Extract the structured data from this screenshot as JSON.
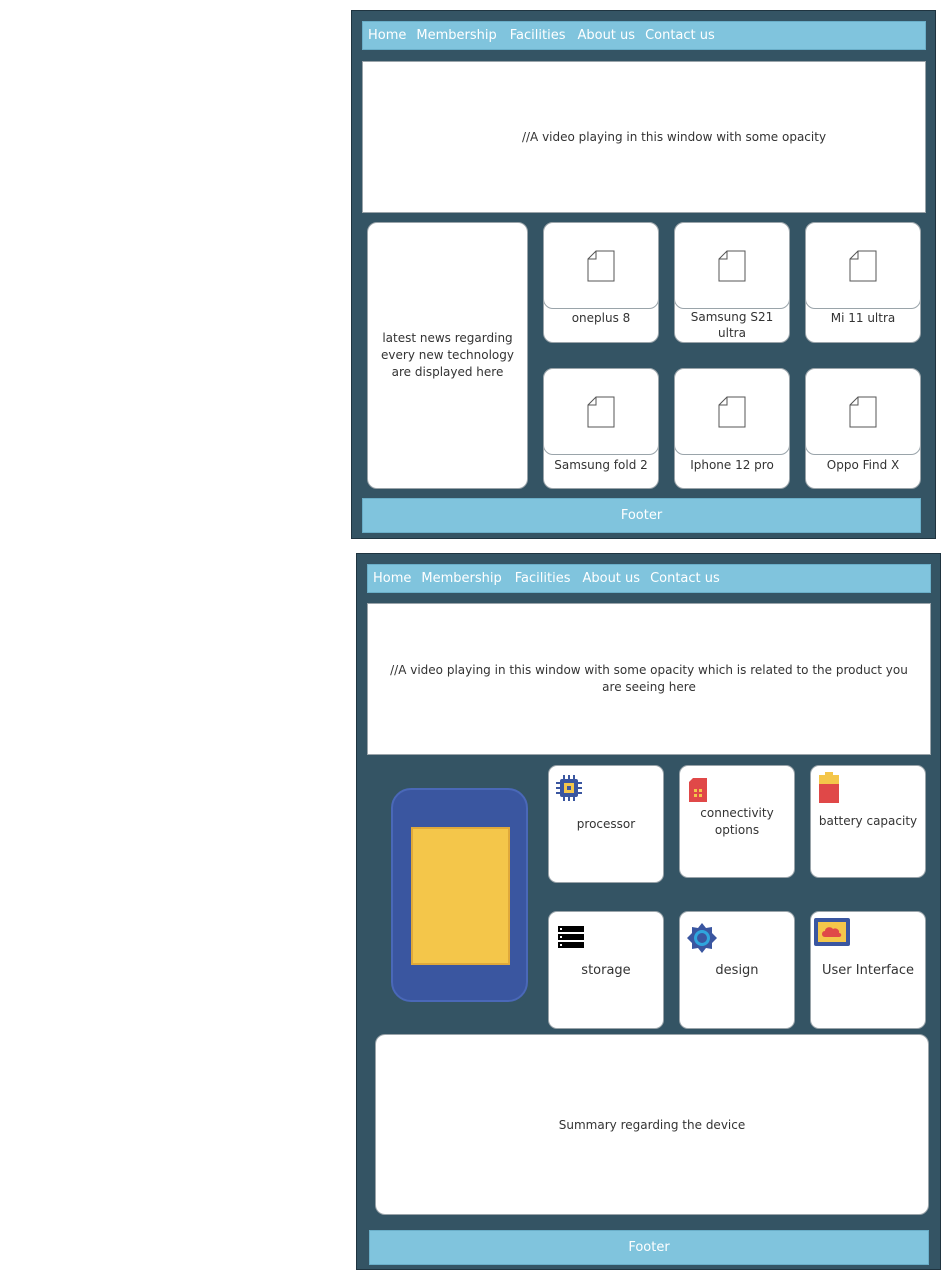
{
  "screen1": {
    "nav": [
      "Home",
      "Membership",
      "Facilities",
      "About us",
      "Contact us"
    ],
    "video_text": "//A video playing in this  window with some opacity",
    "news_text": "latest news regarding every new technology are displayed here",
    "products": [
      "oneplus 8",
      "Samsung S21 ultra",
      "Mi 11 ultra",
      "Samsung fold 2",
      "Iphone 12 pro",
      "Oppo Find X"
    ],
    "footer": "Footer"
  },
  "screen2": {
    "nav": [
      "Home",
      "Membership",
      "Facilities",
      "About us",
      "Contact us"
    ],
    "video_text": "//A video playing in this  window with some opacity which is related to the product you are seeing here",
    "features": [
      {
        "label": "processor",
        "icon": "processor-chip-icon"
      },
      {
        "label": "connectivity options",
        "icon": "sim-card-icon"
      },
      {
        "label": "battery capacity",
        "icon": "battery-icon"
      },
      {
        "label": "storage",
        "icon": "storage-server-icon"
      },
      {
        "label": "design",
        "icon": "design-gear-icon"
      },
      {
        "label": "User Interface",
        "icon": "user-interface-cloud-icon"
      }
    ],
    "summary_text": "Summary regarding the device",
    "footer": "Footer"
  },
  "colors": {
    "frame_bg": "#345464",
    "nav_bg": "#80c4dd",
    "phone_body": "#3a56a0",
    "phone_screen": "#f4c64a"
  }
}
